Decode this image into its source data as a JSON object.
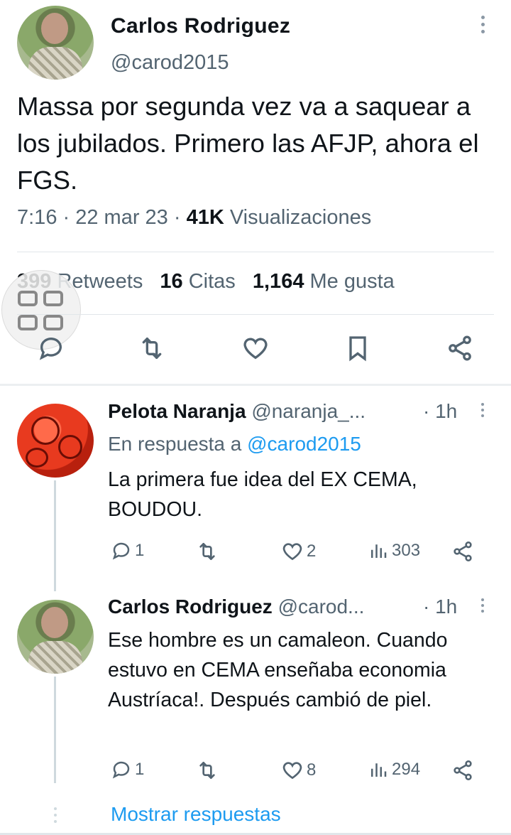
{
  "main_tweet": {
    "author_name": "Carlos  Rodriguez",
    "author_handle": "@carod2015",
    "text": "Massa por segunda vez va a saquear a los jubilados. Primero las AFJP, ahora el FGS.",
    "time": "7:16",
    "date": "22 mar 23",
    "views_count": "41K",
    "views_label": "Visualizaciones",
    "retweets_count": "399",
    "retweets_label": "Retweets",
    "quotes_count": "16",
    "quotes_label": "Citas",
    "likes_count": "1,164",
    "likes_label": "Me gusta"
  },
  "replies": [
    {
      "author_name": "Pelota Naranja",
      "author_handle": "@naranja_...",
      "time": "· 1h",
      "reply_to_prefix": "En respuesta a",
      "reply_to_handle": "@carod2015",
      "text": "La primera fue idea del EX CEMA, BOUDOU.",
      "replies": "1",
      "likes": "2",
      "views": "303"
    },
    {
      "author_name": "Carlos  Rodriguez",
      "author_handle": "@carod...",
      "time": "· 1h",
      "text": "Ese hombre es un camaleon. Cuando estuvo en CEMA enseñaba economia Austríaca!. Después cambió de piel.",
      "replies": "1",
      "likes": "8",
      "views": "294"
    }
  ],
  "show_replies_label": "Mostrar respuestas",
  "colors": {
    "accent": "#1d9bf0",
    "secondary_text": "#536471",
    "primary_text": "#0f1419"
  },
  "icons": [
    "reply-icon",
    "retweet-icon",
    "like-icon",
    "bookmark-icon",
    "share-icon",
    "views-icon",
    "more-icon",
    "grid-overlay-icon"
  ]
}
